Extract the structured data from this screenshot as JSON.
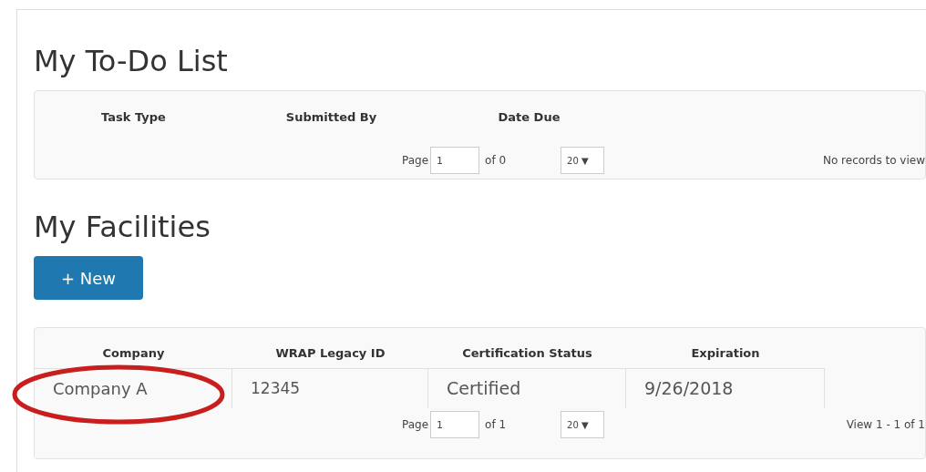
{
  "todo": {
    "title": "My To-Do List",
    "columns": [
      "Task Type",
      "Submitted By",
      "Date Due"
    ],
    "pager": {
      "page_label": "Page",
      "page": "1",
      "of": "of 0",
      "page_size": "20 ▼",
      "records": "No records to view"
    }
  },
  "facilities": {
    "title": "My Facilities",
    "new_button": "+ New",
    "columns": [
      "Company",
      "WRAP Legacy ID",
      "Certification Status",
      "Expiration"
    ],
    "rows": [
      {
        "cells": [
          "Company A",
          "12345",
          "Certified",
          "9/26/2018"
        ],
        "circled": true
      }
    ],
    "pager": {
      "page_label": "Page",
      "page": "1",
      "of": "of 1",
      "page_size": "20 ▼",
      "records": "View 1 - 1 of 1"
    }
  }
}
